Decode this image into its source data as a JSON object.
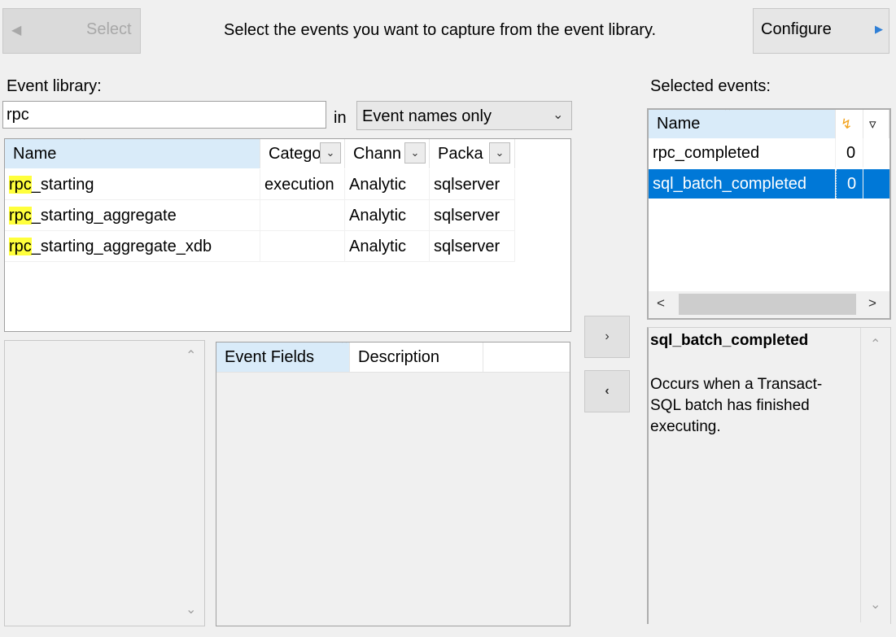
{
  "header": {
    "select_label": "Select",
    "instruction": "Select the events you want to capture from the event library.",
    "configure_label": "Configure"
  },
  "library": {
    "label": "Event library:",
    "search_value": "rpc",
    "in_label": "in",
    "scope_value": "Event names only",
    "columns": {
      "name": "Name",
      "category": "Catego",
      "channel": "Chann",
      "package": "Packa"
    },
    "rows": [
      {
        "match": "rpc",
        "rest": "_starting",
        "category": "execution",
        "channel": "Analytic",
        "package": "sqlserver"
      },
      {
        "match": "rpc",
        "rest": "_starting_aggregate",
        "category": "",
        "channel": "Analytic",
        "package": "sqlserver"
      },
      {
        "match": "rpc",
        "rest": "_starting_aggregate_xdb",
        "category": "",
        "channel": "Analytic",
        "package": "sqlserver"
      }
    ]
  },
  "fields": {
    "col_event_fields": "Event Fields",
    "col_description": "Description"
  },
  "selected": {
    "label": "Selected events:",
    "col_name": "Name",
    "rows": [
      {
        "name": "rpc_completed",
        "count": "0"
      },
      {
        "name": "sql_batch_completed",
        "count": "0"
      }
    ]
  },
  "description": {
    "title": "sql_batch_completed",
    "text": "Occurs when a Transact-SQL batch has finished executing."
  },
  "icons": {
    "lightning": "lightning-icon",
    "filter": "filter-icon"
  },
  "colors": {
    "selection": "#0078d7",
    "highlight": "#ffff3c",
    "sorted_header": "#d9ebf9"
  }
}
